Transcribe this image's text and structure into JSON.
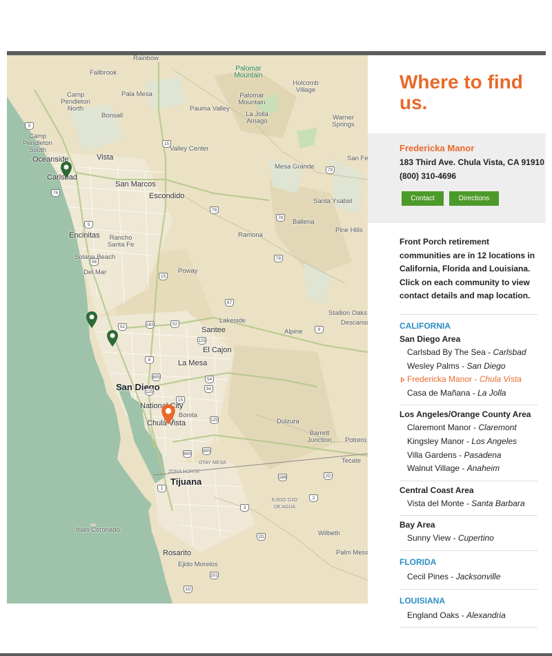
{
  "panel": {
    "title": "Where to find us.",
    "selected": {
      "name": "Fredericka Manor",
      "address": "183 Third Ave. Chula Vista, CA 91910",
      "phone": "(800) 310-4696",
      "contact_label": "Contact",
      "directions_label": "Directions"
    },
    "intro": "Front Porch retirement communities are in 12 locations in California, Florida and Louisiana. Click on each community to view contact details and map location.",
    "states": [
      {
        "name": "CALIFORNIA",
        "areas": [
          {
            "name": "San Diego Area",
            "locations": [
              {
                "name": "Carlsbad By The Sea",
                "city": "Carlsbad"
              },
              {
                "name": "Wesley Palms",
                "city": "San Diego"
              },
              {
                "name": "Fredericka Manor",
                "city": "Chula Vista",
                "active": true
              },
              {
                "name": "Casa de Mañana",
                "city": "La Jolla"
              }
            ]
          },
          {
            "name": "Los Angeles/Orange County Area",
            "locations": [
              {
                "name": "Claremont Manor",
                "city": "Claremont"
              },
              {
                "name": "Kingsley Manor",
                "city": "Los Angeles"
              },
              {
                "name": "Villa Gardens",
                "city": "Pasadena"
              },
              {
                "name": "Walnut Village",
                "city": "Anaheim"
              }
            ]
          },
          {
            "name": "Central Coast Area",
            "locations": [
              {
                "name": "Vista del Monte",
                "city": "Santa Barbara"
              }
            ]
          },
          {
            "name": "Bay Area",
            "locations": [
              {
                "name": "Sunny View",
                "city": "Cupertino"
              }
            ]
          }
        ]
      },
      {
        "name": "FLORIDA",
        "areas": [
          {
            "name": "",
            "locations": [
              {
                "name": "Cecil Pines",
                "city": "Jacksonville"
              }
            ]
          }
        ]
      },
      {
        "name": "LOUISIANA",
        "areas": [
          {
            "name": "",
            "locations": [
              {
                "name": "England Oaks",
                "city": "Alexandria"
              }
            ]
          }
        ]
      }
    ]
  },
  "map": {
    "labels": [
      "Rainbow",
      "Fallbrook",
      "Palomar Mountain",
      "Holcomb Village",
      "Camp Pendleton North",
      "Pala Mesa",
      "Palomar Mountain",
      "Pauma Valley",
      "La Jolla Amago",
      "Warner Springs",
      "Bonsall",
      "Camp Pendleton South",
      "Oceanside",
      "Vista",
      "Valley Center",
      "San Fel",
      "Carlsbad",
      "San Marcos",
      "Mesa Grande",
      "Escondido",
      "Santa Ysabel",
      "Ballena",
      "Pine Hills",
      "Encinitas",
      "Rancho Santa Fe",
      "Ramona",
      "Solana Beach",
      "Del Mar",
      "Poway",
      "Stallion Oaks",
      "Descanso",
      "Lakeside",
      "Santee",
      "Alpine",
      "El Cajon",
      "La Mesa",
      "San Diego",
      "National City",
      "Bonita",
      "Chula Vista",
      "Dulzura",
      "Barrett Junction",
      "Potrero",
      "Tecate",
      "OTAY MESA",
      "ZONA NORTE",
      "Tijuana",
      "EJIDO OJO DE AGUA",
      "Islas Coronado",
      "Wilbeth",
      "Palm Mesa",
      "Rosarito",
      "Ejido Morelos"
    ],
    "shields": [
      "5",
      "15",
      "76",
      "78",
      "79",
      "56",
      "15",
      "78",
      "78",
      "5",
      "67",
      "8",
      "163",
      "52",
      "52",
      "125",
      "805",
      "54",
      "125",
      "94",
      "805",
      "905",
      "15",
      "125",
      "8",
      "1",
      "94",
      "188",
      "2",
      "3",
      "201",
      "1D",
      "2D",
      "2D"
    ],
    "pin_colors": {
      "community": "#2d6a34",
      "selected": "#e8692a"
    }
  }
}
